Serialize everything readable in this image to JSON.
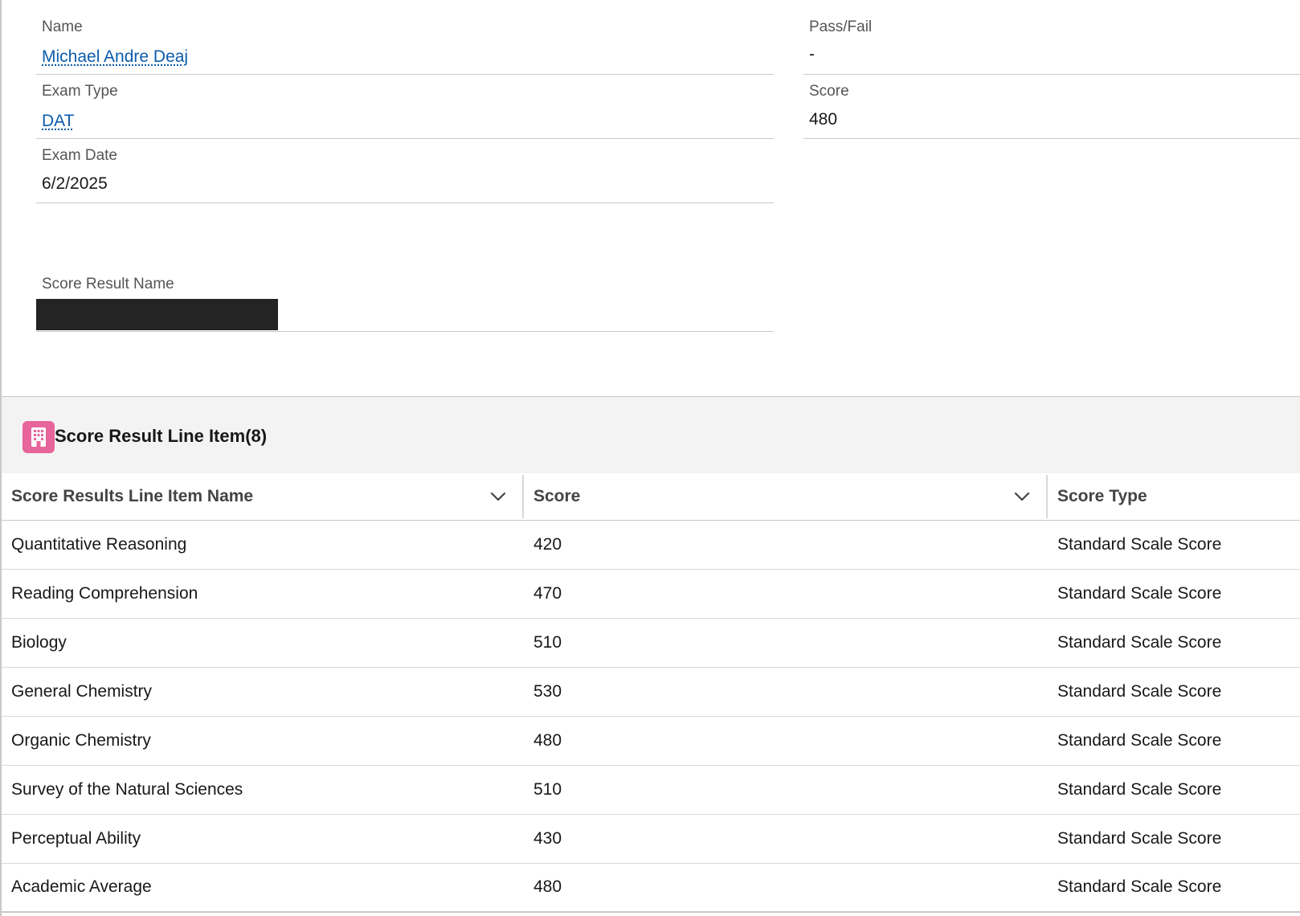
{
  "fields": {
    "name": {
      "label": "Name",
      "value": "Michael Andre Deaj"
    },
    "pass_fail": {
      "label": "Pass/Fail",
      "value": "-"
    },
    "exam_type": {
      "label": "Exam Type",
      "value": "DAT"
    },
    "score": {
      "label": "Score",
      "value": "480"
    },
    "exam_date": {
      "label": "Exam Date",
      "value": "6/2/2025"
    },
    "score_result_name": {
      "label": "Score Result Name"
    }
  },
  "related_list": {
    "title": "Score Result Line Item",
    "count": "(8)",
    "icon": "building-icon",
    "icon_color": "#e7659a",
    "columns": [
      "Score Results Line Item Name",
      "Score",
      "Score Type"
    ],
    "rows": [
      {
        "name": "Quantitative Reasoning",
        "score": "420",
        "type": "Standard Scale Score"
      },
      {
        "name": "Reading Comprehension",
        "score": "470",
        "type": "Standard Scale Score"
      },
      {
        "name": "Biology",
        "score": "510",
        "type": "Standard Scale Score"
      },
      {
        "name": "General Chemistry",
        "score": "530",
        "type": "Standard Scale Score"
      },
      {
        "name": "Organic Chemistry",
        "score": "480",
        "type": "Standard Scale Score"
      },
      {
        "name": "Survey of the Natural Sciences",
        "score": "510",
        "type": "Standard Scale Score"
      },
      {
        "name": "Perceptual Ability",
        "score": "430",
        "type": "Standard Scale Score"
      },
      {
        "name": "Academic Average",
        "score": "480",
        "type": "Standard Scale Score"
      }
    ]
  },
  "colors": {
    "link": "#0b5cab",
    "redaction": "#242424",
    "header_bg": "#f3f3f3"
  }
}
